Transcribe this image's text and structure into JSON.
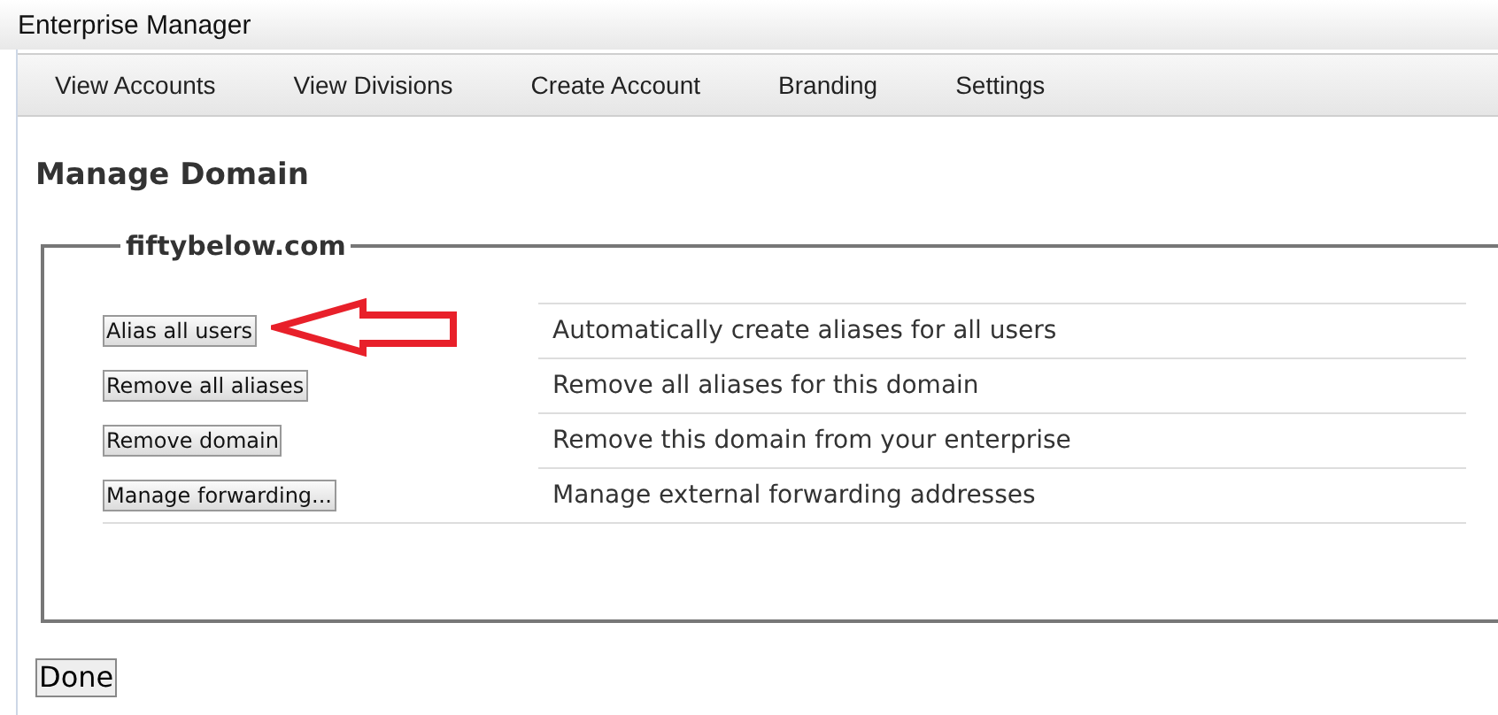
{
  "window": {
    "title": "Enterprise Manager"
  },
  "nav": [
    {
      "label": "View Accounts"
    },
    {
      "label": "View Divisions"
    },
    {
      "label": "Create Account"
    },
    {
      "label": "Branding"
    },
    {
      "label": "Settings"
    }
  ],
  "heading": "Manage Domain",
  "domain": {
    "legend": "fiftybelow.com",
    "actions": [
      {
        "button": "Alias all users",
        "description": "Automatically create aliases for all users",
        "highlighted": true
      },
      {
        "button": "Remove all aliases",
        "description": "Remove all aliases for this domain",
        "highlighted": false
      },
      {
        "button": "Remove domain",
        "description": "Remove this domain from your enterprise",
        "highlighted": false
      },
      {
        "button": "Manage forwarding...",
        "description": "Manage external forwarding addresses",
        "highlighted": false
      }
    ]
  },
  "done_button": "Done"
}
